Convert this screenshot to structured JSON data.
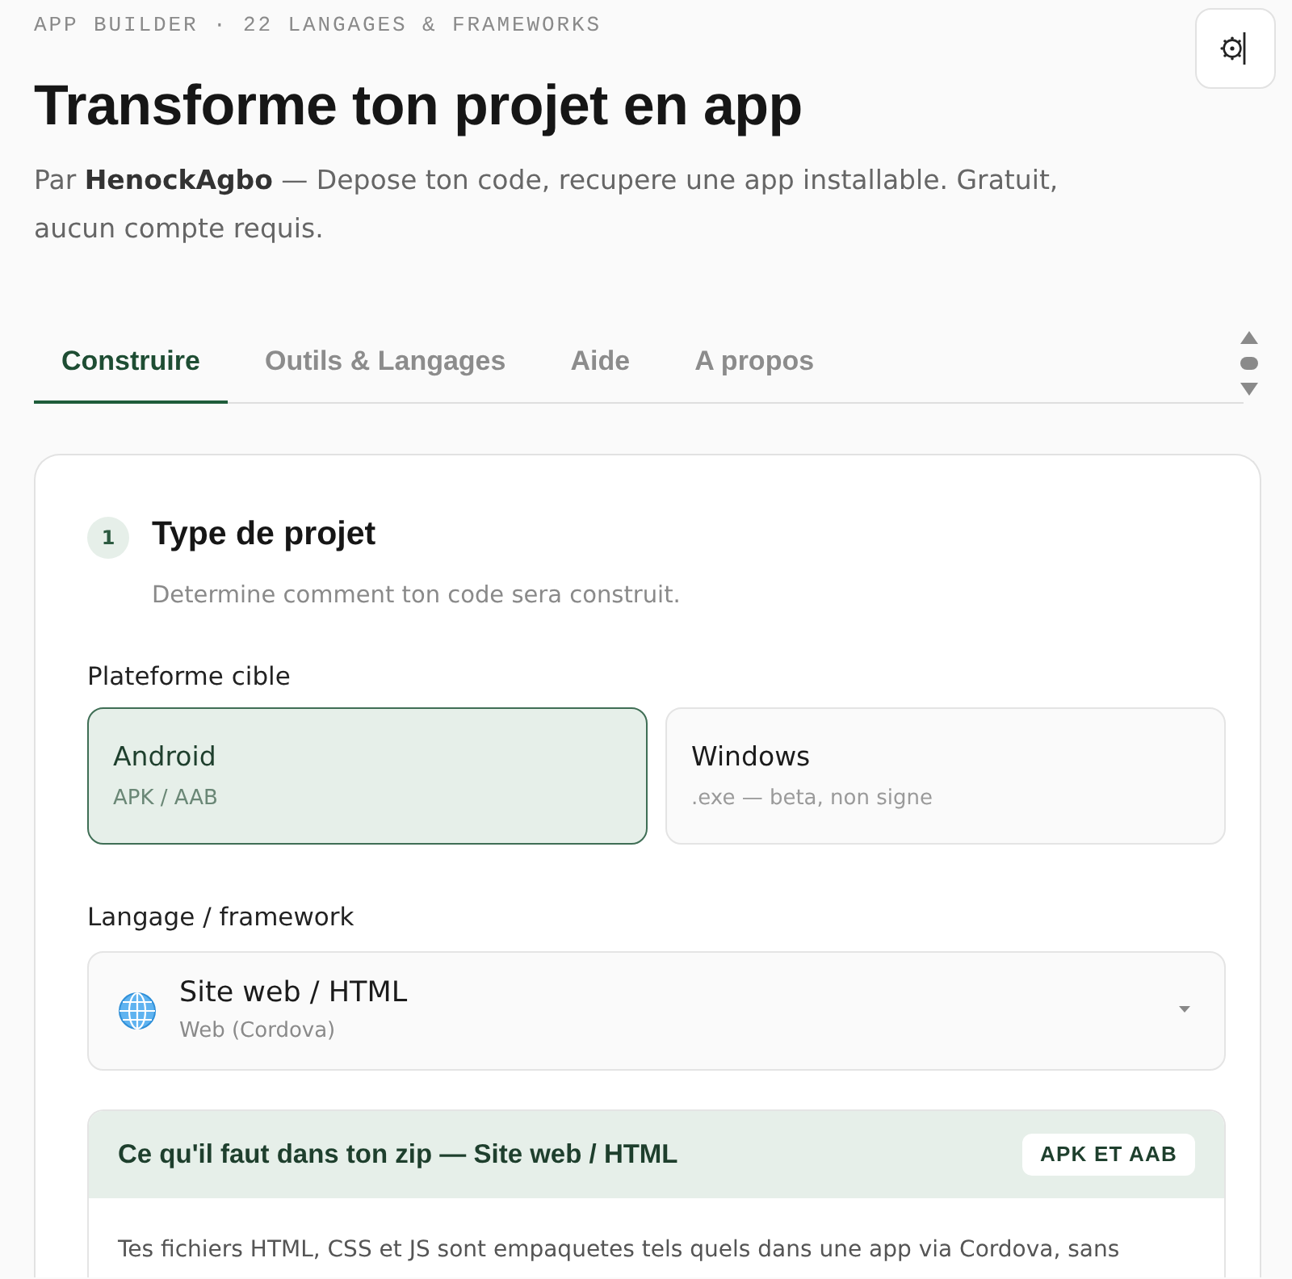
{
  "header": {
    "eyebrow": "APP BUILDER · 22 LANGAGES & FRAMEWORKS",
    "title": "Transforme ton projet en app",
    "subtitle": "Par **HenockAgbo** — Depose ton code, recupere une app installable. Gratuit, aucun compte requis."
  },
  "tabs": [
    {
      "label": "Construire",
      "selected": true
    },
    {
      "label": "Outils & Langages",
      "selected": false
    },
    {
      "label": "Aide",
      "selected": false
    },
    {
      "label": "A propos",
      "selected": false
    }
  ],
  "step": {
    "number": "1",
    "title": "Type de projet",
    "description": "Determine comment ton code sera construit."
  },
  "platform": {
    "label": "Plateforme cible",
    "options": [
      {
        "name": "Android",
        "detail": "APK / AAB",
        "selected": true
      },
      {
        "name": "Windows",
        "detail": ".exe — beta, non signe",
        "selected": false
      }
    ]
  },
  "framework": {
    "label": "Langage / framework",
    "value": "Site web / HTML",
    "detail": "Web (Cordova)"
  },
  "requirements": {
    "title": "Ce qu'il faut dans ton zip — Site web / HTML",
    "badge": "APK ET AAB",
    "body": "Tes fichiers HTML, CSS et JS sont empaquetes tels quels dans une app via Cordova, sans"
  }
}
